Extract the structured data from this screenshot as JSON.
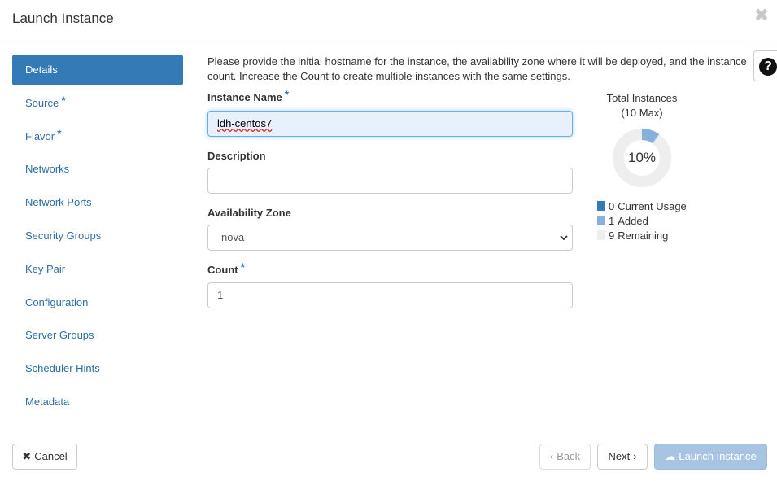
{
  "header": {
    "title": "Launch Instance"
  },
  "nav": {
    "items": [
      {
        "label": "Details",
        "active": true,
        "required": false
      },
      {
        "label": "Source",
        "active": false,
        "required": true
      },
      {
        "label": "Flavor",
        "active": false,
        "required": true
      },
      {
        "label": "Networks",
        "active": false,
        "required": false
      },
      {
        "label": "Network Ports",
        "active": false,
        "required": false
      },
      {
        "label": "Security Groups",
        "active": false,
        "required": false
      },
      {
        "label": "Key Pair",
        "active": false,
        "required": false
      },
      {
        "label": "Configuration",
        "active": false,
        "required": false
      },
      {
        "label": "Server Groups",
        "active": false,
        "required": false
      },
      {
        "label": "Scheduler Hints",
        "active": false,
        "required": false
      },
      {
        "label": "Metadata",
        "active": false,
        "required": false
      }
    ],
    "required_marker": "*"
  },
  "intro": "Please provide the initial hostname for the instance, the availability zone where it will be deployed, and the instance count. Increase the Count to create multiple instances with the same settings.",
  "form": {
    "instance_name": {
      "label": "Instance Name",
      "value": "ldh-centos7"
    },
    "description": {
      "label": "Description",
      "value": ""
    },
    "availability_zone": {
      "label": "Availability Zone",
      "value": "nova"
    },
    "count": {
      "label": "Count",
      "value": "1"
    }
  },
  "summary": {
    "title": "Total Instances",
    "subtitle": "(10 Max)",
    "percent_label": "10%",
    "fraction_used": 0.1,
    "legend": [
      {
        "count": "0",
        "label": "Current Usage",
        "color": "#337ab7"
      },
      {
        "count": "1",
        "label": "Added",
        "color": "#87b0dd"
      },
      {
        "count": "9",
        "label": "Remaining",
        "color": "#eeeeee"
      }
    ]
  },
  "footer": {
    "cancel_label": "Cancel",
    "back_label": "Back",
    "next_label": "Next",
    "launch_label": "Launch Instance"
  },
  "icons": {
    "close": "close-icon",
    "help": "question-icon",
    "cancel": "times-icon",
    "back": "chevron-left-icon",
    "next": "chevron-right-icon",
    "launch": "cloud-upload-icon"
  }
}
